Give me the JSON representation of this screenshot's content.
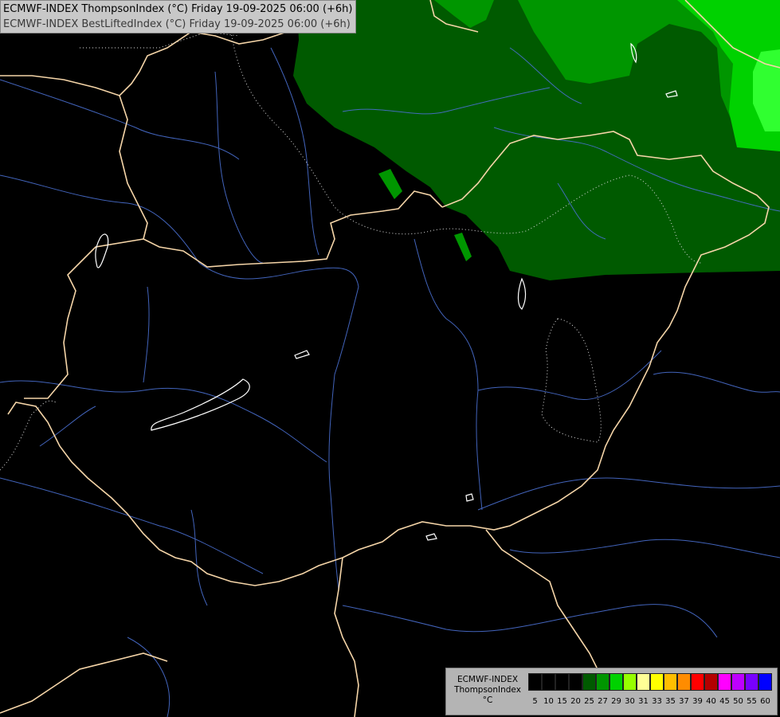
{
  "title": {
    "line1": "ECMWF-INDEX ThompsonIndex (°C) Friday 19-09-2025 06:00 (+6h)",
    "line2": "ECMWF-INDEX BestLiftedIndex (°C) Friday 19-09-2025 06:00 (+6h)"
  },
  "legend": {
    "model": "ECMWF-INDEX",
    "param": "ThompsonIndex",
    "unit": "°C",
    "swatches": [
      {
        "color": "#000000"
      },
      {
        "color": "#000000"
      },
      {
        "color": "#000000"
      },
      {
        "color": "#000000"
      },
      {
        "color": "#005a00"
      },
      {
        "color": "#009600"
      },
      {
        "color": "#00d200"
      },
      {
        "color": "#96ff00"
      },
      {
        "color": "#ffff96"
      },
      {
        "color": "#ffff00"
      },
      {
        "color": "#ffbe00"
      },
      {
        "color": "#ff8c00"
      },
      {
        "color": "#ff0000"
      },
      {
        "color": "#b40000"
      },
      {
        "color": "#ff00ff"
      },
      {
        "color": "#be00ff"
      },
      {
        "color": "#7800ff"
      },
      {
        "color": "#0000ff"
      }
    ],
    "ticks": [
      "5",
      "10",
      "15",
      "20",
      "25",
      "27",
      "29",
      "30",
      "31",
      "33",
      "35",
      "37",
      "39",
      "40",
      "45",
      "50",
      "55",
      "60"
    ]
  }
}
